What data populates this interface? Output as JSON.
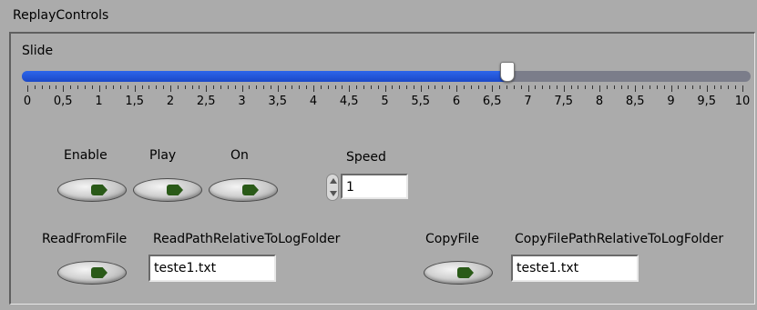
{
  "window": {
    "title": "ReplayControls"
  },
  "slide": {
    "label": "Slide",
    "value": 6.7,
    "min": 0,
    "max": 10,
    "tick_labels": [
      "0",
      "0,5",
      "1",
      "1,5",
      "2",
      "2,5",
      "3",
      "3,5",
      "4",
      "4,5",
      "5",
      "5,5",
      "6",
      "6,5",
      "7",
      "7,5",
      "8",
      "8,5",
      "9",
      "9,5",
      "10"
    ],
    "fill_color": "#2a5fe0",
    "track_color": "#7b7d8a"
  },
  "controls": {
    "enable_label": "Enable",
    "play_label": "Play",
    "on_label": "On",
    "speed_label": "Speed",
    "speed_value": "1",
    "readfromfile_label": "ReadFromFile",
    "readpath_label": "ReadPathRelativeToLogFolder",
    "readpath_value": "teste1.txt",
    "copyfile_label": "CopyFile",
    "copypath_label": "CopyFilePathRelativeToLogFolder",
    "copypath_value": "teste1.txt"
  },
  "icons": {
    "led": "led-indicator-icon",
    "spinner_up": "spin-up-icon",
    "spinner_down": "spin-down-icon"
  }
}
